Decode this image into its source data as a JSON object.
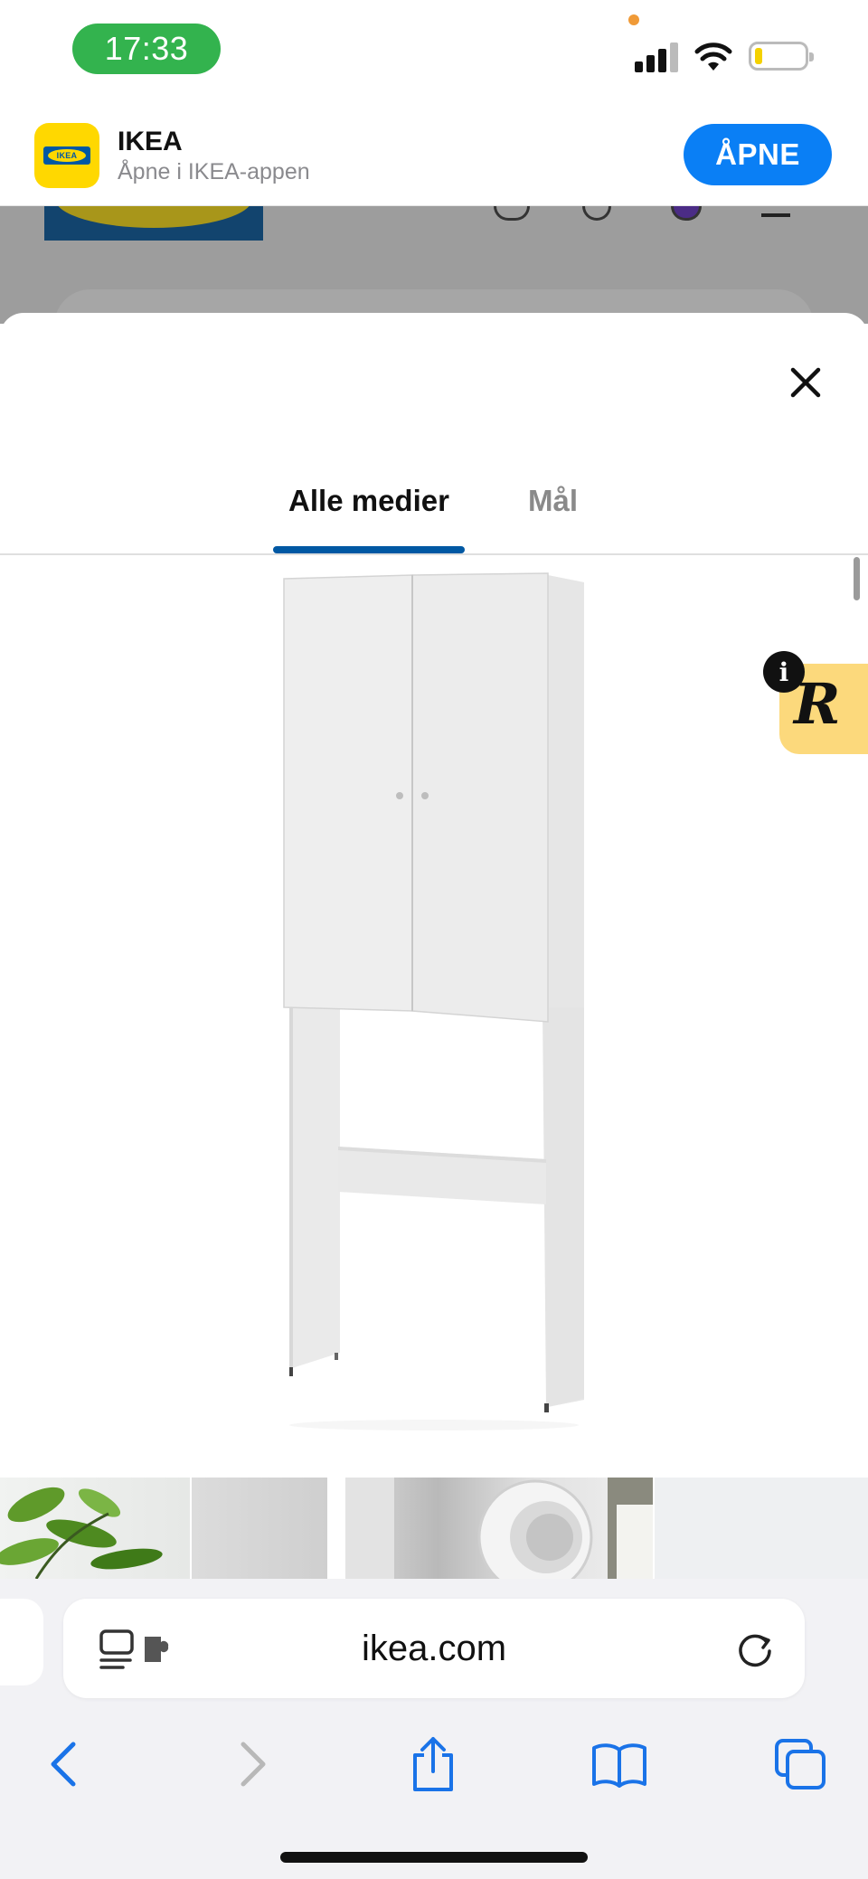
{
  "status_bar": {
    "time": "17:33",
    "signal_icon": "cellular-signal-icon",
    "wifi_icon": "wifi-icon",
    "battery_icon": "battery-icon",
    "battery_level": 0.15
  },
  "app_banner": {
    "app_name": "IKEA",
    "subtitle": "Åpne i IKEA-appen",
    "open_label": "ÅPNE",
    "logo_text": "IKEA",
    "accent_color": "#0a7ff5"
  },
  "modal": {
    "close_icon": "close-icon",
    "tabs": [
      {
        "label": "Alle medier",
        "active": true
      },
      {
        "label": "Mål",
        "active": false
      }
    ],
    "active_tab_color": "#0058a3",
    "badge_letter": "R",
    "badge_info": "i"
  },
  "browser": {
    "url": "ikea.com",
    "reader_icon": "reader-mode-icon",
    "extension_icon": "puzzle-extension-icon",
    "reload_icon": "reload-icon",
    "nav": {
      "back_icon": "back-arrow-icon",
      "forward_icon": "forward-arrow-icon",
      "share_icon": "share-icon",
      "bookmarks_icon": "book-icon",
      "tabs_icon": "tabs-icon"
    }
  }
}
